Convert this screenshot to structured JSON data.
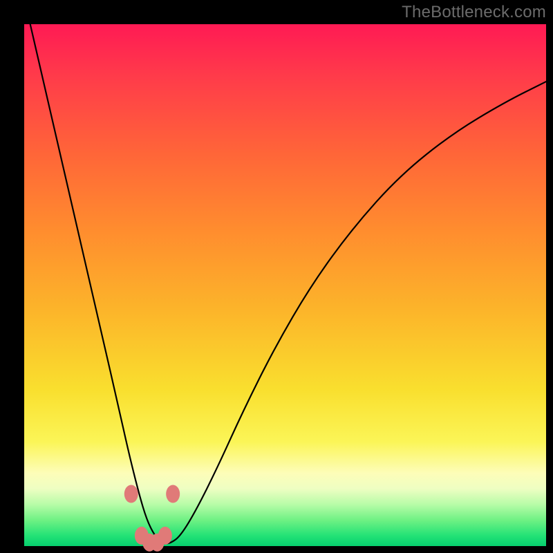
{
  "watermark": "TheBottleneck.com",
  "chart_data": {
    "type": "line",
    "title": "",
    "xlabel": "",
    "ylabel": "",
    "xlim": [
      0,
      100
    ],
    "ylim": [
      0,
      100
    ],
    "grid": false,
    "legend": false,
    "series": [
      {
        "name": "bottleneck-curve",
        "x": [
          0,
          3,
          6,
          9,
          12,
          15,
          18,
          20,
          22,
          23.5,
          25,
          26.5,
          28,
          30,
          33,
          37,
          42,
          48,
          55,
          63,
          72,
          82,
          92,
          100
        ],
        "y": [
          105,
          92,
          79,
          66,
          53,
          40,
          27,
          18,
          10,
          5,
          2,
          0.5,
          0.5,
          2,
          7,
          15,
          26,
          38,
          50,
          61,
          71,
          79,
          85,
          89
        ]
      }
    ],
    "markers": [
      {
        "x": 20.5,
        "y": 10
      },
      {
        "x": 28.5,
        "y": 10
      },
      {
        "x": 22.5,
        "y": 2
      },
      {
        "x": 24.0,
        "y": 0.7
      },
      {
        "x": 25.5,
        "y": 0.7
      },
      {
        "x": 27.0,
        "y": 2
      }
    ],
    "marker_color": "#e07a78",
    "curve_color": "#000000"
  }
}
